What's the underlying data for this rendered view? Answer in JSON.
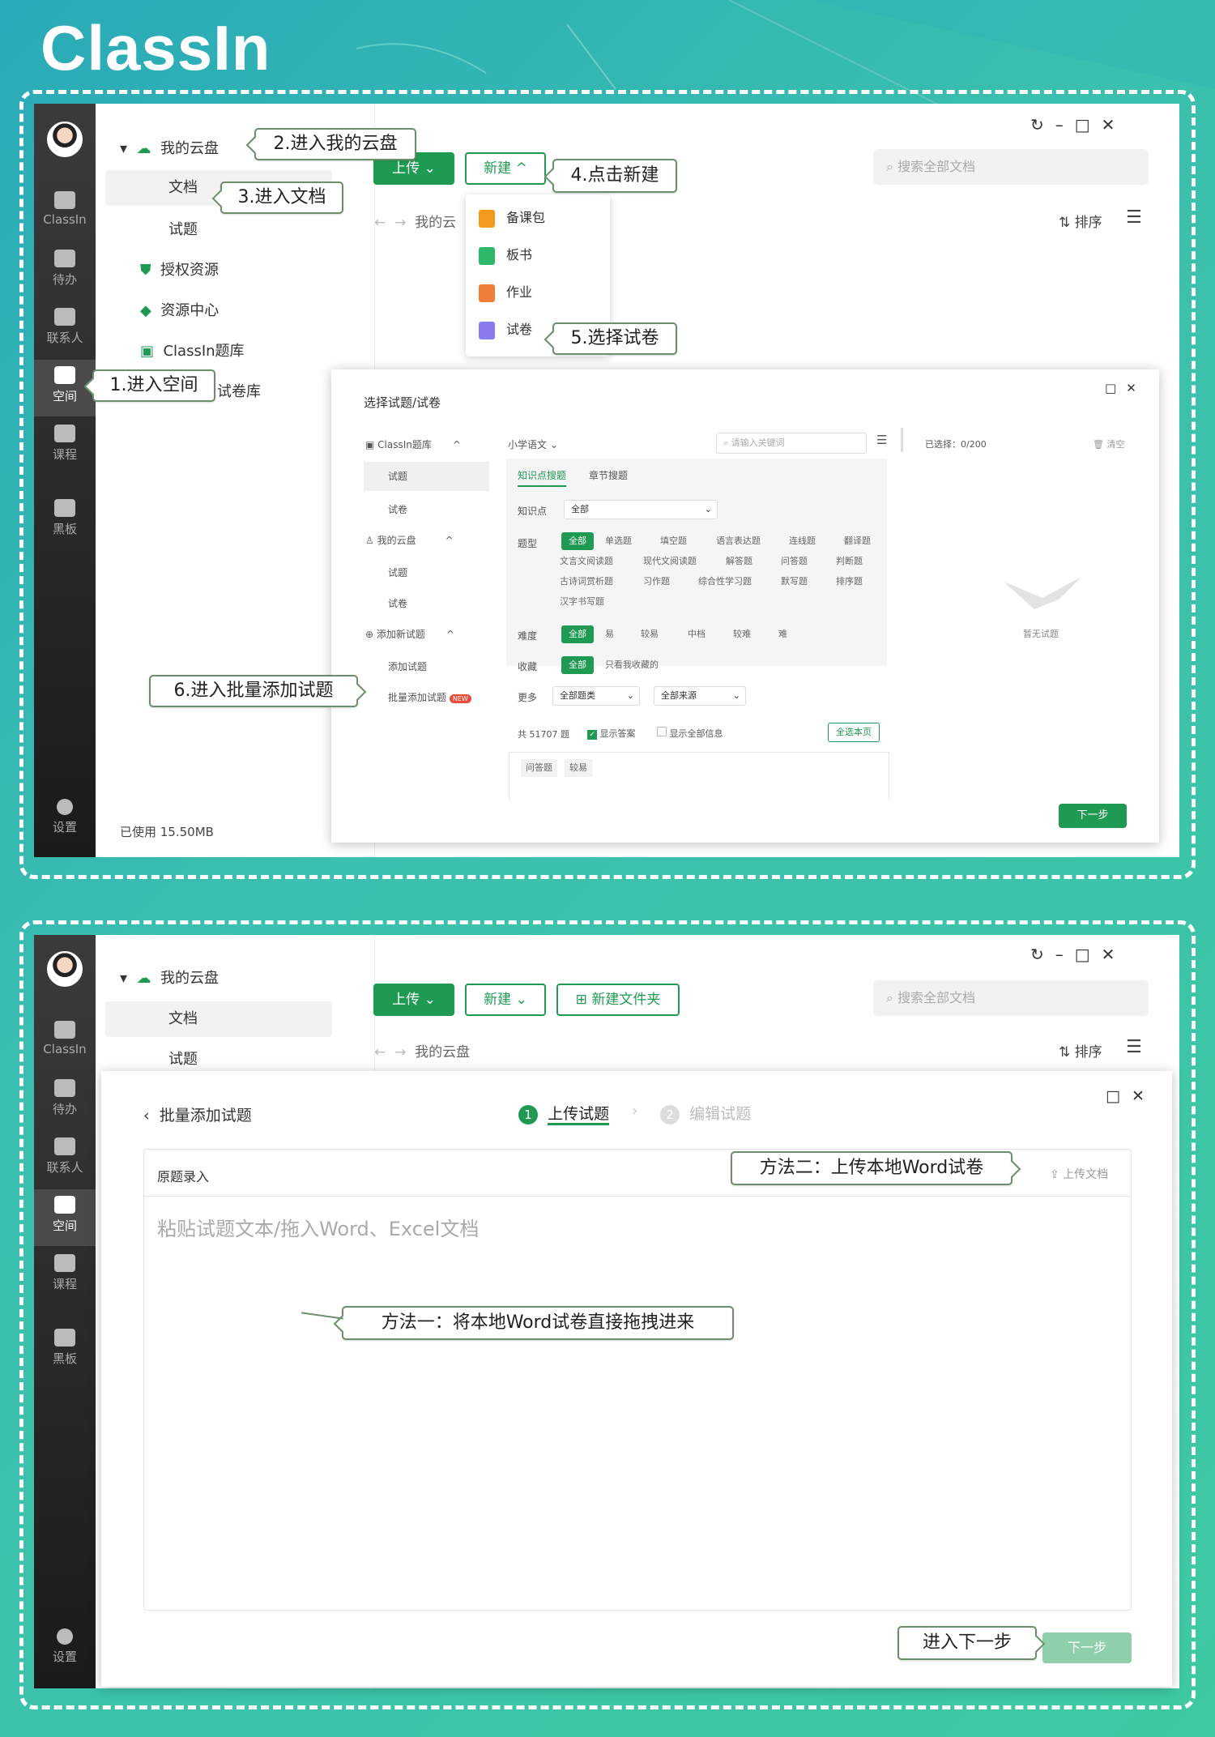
{
  "brand": {
    "logo": "ClassIn"
  },
  "colors": {
    "green": "#1f9a53",
    "bg_teal": "#3ec9a2",
    "sidebar": "#2a2a2a"
  },
  "panel1": {
    "sidebar": [
      {
        "label": "ClassIn",
        "icon": "home-icon"
      },
      {
        "label": "待办",
        "icon": "todo-icon"
      },
      {
        "label": "联系人",
        "icon": "contacts-icon"
      },
      {
        "label": "空间",
        "icon": "space-icon"
      },
      {
        "label": "课程",
        "icon": "course-icon"
      },
      {
        "label": "黑板",
        "icon": "blackboard-icon"
      },
      {
        "label": "设置",
        "icon": "settings-icon"
      }
    ],
    "tree": {
      "cloud": "我的云盘",
      "doc": "文档",
      "quiz": "试题",
      "auth": "授权资源",
      "resource": "资源中心",
      "bank": "ClassIn题库",
      "paperbank": "试卷库"
    },
    "storage": "已使用 15.50MB",
    "more": "···",
    "toolbar": {
      "upload": "上传",
      "new": "新建",
      "search_placeholder": "搜索全部文档",
      "crumb": "我的云",
      "sort": "排序"
    },
    "new_menu": [
      "备课包",
      "板书",
      "作业",
      "试卷"
    ],
    "callouts": {
      "c1": "1.进入空间",
      "c2": "2.进入我的云盘",
      "c3": "3.进入文档",
      "c4": "4.点击新建",
      "c5": "5.选择试卷",
      "c6": "6.进入批量添加试题"
    },
    "dialog": {
      "title": "选择试题/试卷",
      "left": {
        "bank": "ClassIn题库",
        "bank_quiz": "试题",
        "bank_paper": "试卷",
        "cloud": "我的云盘",
        "cloud_quiz": "试题",
        "cloud_paper": "试卷",
        "addnew": "添加新试题",
        "add": "添加试题",
        "batch": "批量添加试题",
        "new_badge": "NEW"
      },
      "grade": "小学语文",
      "kw_placeholder": "请输入关键词",
      "tabs": [
        "知识点搜题",
        "章节搜题"
      ],
      "filters": {
        "kp_label": "知识点",
        "kp_value": "全部",
        "type_label": "题型",
        "types": [
          "全部",
          "单选题",
          "填空题",
          "语言表达题",
          "连线题",
          "翻译题",
          "文言文阅读题",
          "现代文阅读题",
          "解答题",
          "问答题",
          "判断题",
          "古诗词赏析题",
          "习作题",
          "综合性学习题",
          "默写题",
          "排序题",
          "汉字书写题"
        ],
        "diff_label": "难度",
        "diffs": [
          "全部",
          "易",
          "较易",
          "中档",
          "较难",
          "难"
        ],
        "fav_label": "收藏",
        "favs": [
          "全部",
          "只看我收藏的"
        ],
        "more_label": "更多",
        "more_type": "全部题类",
        "more_src": "全部来源"
      },
      "count": "共 51707 题",
      "show_answer": "显示答案",
      "show_all": "显示全部信息",
      "select_page": "全选本页",
      "preview_tags": [
        "问答题",
        "较易"
      ],
      "selected": "已选择：0/200",
      "clear": "清空",
      "empty": "暂无试题",
      "next": "下一步"
    }
  },
  "panel2": {
    "sidebar": [
      {
        "label": "ClassIn"
      },
      {
        "label": "待办"
      },
      {
        "label": "联系人"
      },
      {
        "label": "空间"
      },
      {
        "label": "课程"
      },
      {
        "label": "黑板"
      },
      {
        "label": "设置"
      }
    ],
    "tree": {
      "cloud": "我的云盘",
      "doc": "文档",
      "quiz": "试题"
    },
    "toolbar": {
      "upload": "上传",
      "new": "新建",
      "newfolder": "新建文件夹",
      "search_placeholder": "搜索全部文档",
      "crumb": "我的云盘",
      "sort": "排序"
    },
    "batch": {
      "back_title": "批量添加试题",
      "step1": "上传试题",
      "step2": "编辑试题",
      "step1_num": "1",
      "step2_num": "2",
      "source": "原题录入",
      "upload_doc": "上传文档",
      "placeholder": "粘贴试题文本/拖入Word、Excel文档",
      "next": "下一步"
    },
    "callouts": {
      "m1": "方法一：将本地Word试卷直接拖拽进来",
      "m2": "方法二：上传本地Word试卷",
      "next": "进入下一步"
    }
  }
}
